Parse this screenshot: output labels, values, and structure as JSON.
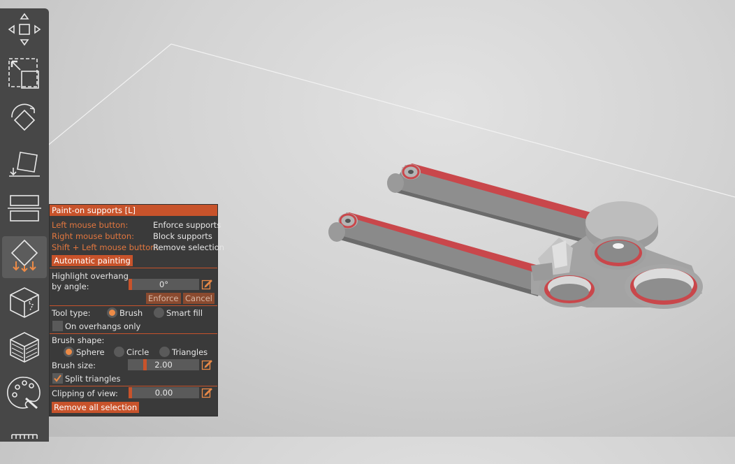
{
  "panel": {
    "title": "Paint-on supports [L]",
    "hints": [
      {
        "key": "Left mouse button:",
        "action": "Enforce supports"
      },
      {
        "key": "Right mouse button:",
        "action": "Block supports"
      },
      {
        "key": "Shift + Left mouse button:",
        "action": "Remove selection"
      }
    ],
    "automatic_painting": "Automatic painting",
    "highlight_label_1": "Highlight overhang",
    "highlight_label_2": "by angle:",
    "angle_value": "0°",
    "enforce": "Enforce",
    "cancel": "Cancel",
    "tool_type_label": "Tool type:",
    "tool_brush": "Brush",
    "tool_smart_fill": "Smart fill",
    "tool_selected": "Brush",
    "on_overhangs_only": "On overhangs only",
    "on_overhangs_checked": false,
    "brush_shape_label": "Brush shape:",
    "shape_sphere": "Sphere",
    "shape_circle": "Circle",
    "shape_triangles": "Triangles",
    "shape_selected": "Sphere",
    "brush_size_label": "Brush size:",
    "brush_size_value": "2.00",
    "split_triangles": "Split triangles",
    "split_triangles_checked": true,
    "clipping_label": "Clipping of view:",
    "clipping_value": "0.00",
    "remove_all": "Remove all selection"
  },
  "toolbar": {
    "items": [
      "move-icon",
      "scale-icon",
      "rotate-icon",
      "place-on-face-icon",
      "cut-icon",
      "support-paint-icon",
      "seam-paint-icon",
      "fuzzy-skin-icon",
      "mmu-paint-icon",
      "more-icon"
    ],
    "active": "support-paint-icon"
  },
  "colors": {
    "accent": "#c8532b",
    "highlight": "#ed8b47",
    "panel_bg": "#3a3a3a",
    "toolbar_bg": "#474747",
    "model_gray": "#8a8a8a",
    "model_red": "#c9474b"
  }
}
